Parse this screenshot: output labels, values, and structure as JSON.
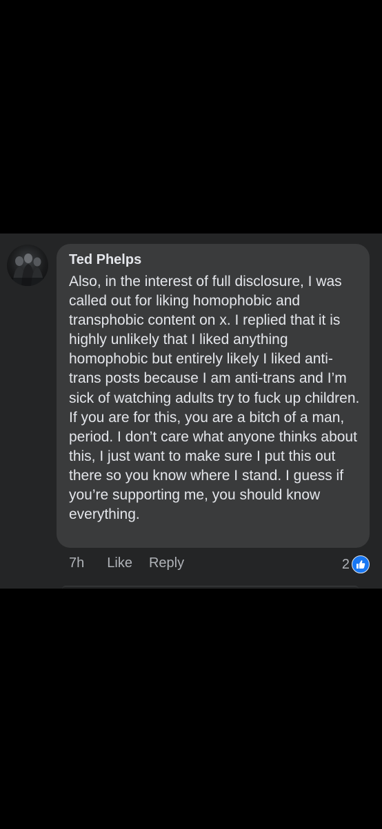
{
  "comment": {
    "author": "Ted Phelps",
    "avatar_icon": "profile-photo",
    "text": "Also, in the interest of full disclosure, I was called out for liking homophobic and transphobic content on x. I replied that it is highly unlikely that I liked anything homophobic but entirely likely I liked anti-trans posts because I am anti-trans and I’m sick of watching adults try to fuck up children. If you are for this, you are a bitch of a man, period. I don’t care what anyone thinks about this, I just want to make sure I put this out there so you know where I stand. I guess if you’re supporting me, you should know everything.",
    "time": "7h",
    "like_label": "Like",
    "reply_label": "Reply",
    "reaction_count": "2",
    "reaction_icon": "thumbs-up-icon"
  },
  "colors": {
    "page_background": "#000000",
    "panel_background": "#242526",
    "bubble_background": "#3a3b3c",
    "primary_text": "#e4e6eb",
    "secondary_text": "#b0b3b8",
    "like_blue": "#1877f2"
  }
}
